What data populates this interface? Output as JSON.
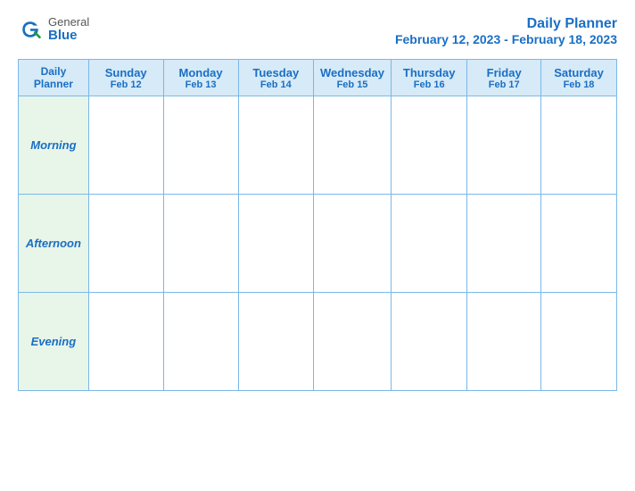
{
  "header": {
    "logo_general": "General",
    "logo_blue": "Blue",
    "planner_title": "Daily Planner",
    "date_range": "February 12, 2023 - February 18, 2023"
  },
  "columns": [
    {
      "id": "label-col",
      "day_name": "Daily",
      "day_name2": "Planner",
      "day_date": ""
    },
    {
      "id": "sun",
      "day_name": "Sunday",
      "day_date": "Feb 12"
    },
    {
      "id": "mon",
      "day_name": "Monday",
      "day_date": "Feb 13"
    },
    {
      "id": "tue",
      "day_name": "Tuesday",
      "day_date": "Feb 14"
    },
    {
      "id": "wed",
      "day_name": "Wednesday",
      "day_date": "Feb 15"
    },
    {
      "id": "thu",
      "day_name": "Thursday",
      "day_date": "Feb 16"
    },
    {
      "id": "fri",
      "day_name": "Friday",
      "day_date": "Feb 17"
    },
    {
      "id": "sat",
      "day_name": "Saturday",
      "day_date": "Feb 18"
    }
  ],
  "rows": [
    {
      "label": "Morning"
    },
    {
      "label": "Afternoon"
    },
    {
      "label": "Evening"
    }
  ]
}
